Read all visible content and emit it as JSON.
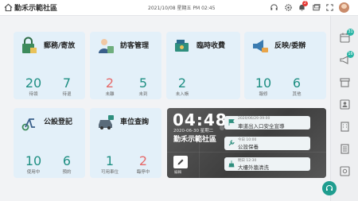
{
  "header": {
    "community_name": "勤禾示範社區",
    "datetime": "2021/10/08  星期五 PM 02:45",
    "notification_count": "2",
    "icons": [
      "home-icon",
      "headset-icon",
      "settings-icon",
      "bell-icon",
      "window-icon",
      "fullscreen-icon",
      "avatar"
    ]
  },
  "cards": {
    "mail": {
      "title": "郵務/寄放",
      "stats": [
        {
          "value": "20",
          "label": "待領",
          "color": "teal"
        },
        {
          "value": "7",
          "label": "待退",
          "color": "teal"
        }
      ]
    },
    "visitor": {
      "title": "訪客管理",
      "stats": [
        {
          "value": "2",
          "label": "未離",
          "color": "red"
        },
        {
          "value": "5",
          "label": "未到",
          "color": "teal"
        }
      ]
    },
    "temp_fee": {
      "title": "臨時收費",
      "stats": [
        {
          "value": "2",
          "label": "未入帳",
          "color": "teal"
        }
      ]
    },
    "feedback": {
      "title": "反映/委辦",
      "stats": [
        {
          "value": "10",
          "label": "報修",
          "color": "teal"
        },
        {
          "value": "6",
          "label": "其他",
          "color": "teal"
        }
      ]
    },
    "facility": {
      "title": "公設登記",
      "stats": [
        {
          "value": "10",
          "label": "使用中",
          "color": "teal"
        },
        {
          "value": "6",
          "label": "預約",
          "color": "teal"
        }
      ]
    },
    "parking": {
      "title": "車位查詢",
      "stats": [
        {
          "value": "1",
          "label": "可用車位",
          "color": "teal"
        },
        {
          "value": "2",
          "label": "臨停中",
          "color": "red"
        }
      ]
    }
  },
  "panel": {
    "clock": "04:48",
    "date": "2020-06-30  星期二",
    "community_name": "勤禾示範社區",
    "edit_label": "編輯",
    "notes": [
      {
        "time": "2020/06/29 09:00",
        "text": "車道出入口安全宣導"
      },
      {
        "time": "今日 10:00",
        "text": "公設保養"
      },
      {
        "time": "明日 12:30",
        "text": "大樓外牆清洗"
      }
    ]
  },
  "sidebar": {
    "badges": [
      "31",
      "16"
    ],
    "items": [
      "calendar-icon",
      "megaphone-icon",
      "archive-icon",
      "id-card-icon",
      "building-icon",
      "document-icon",
      "safe-icon"
    ]
  },
  "colors": {
    "accent": "#1f8f83",
    "alert": "#e66a6a",
    "card_bg": "#e3f0f9"
  }
}
